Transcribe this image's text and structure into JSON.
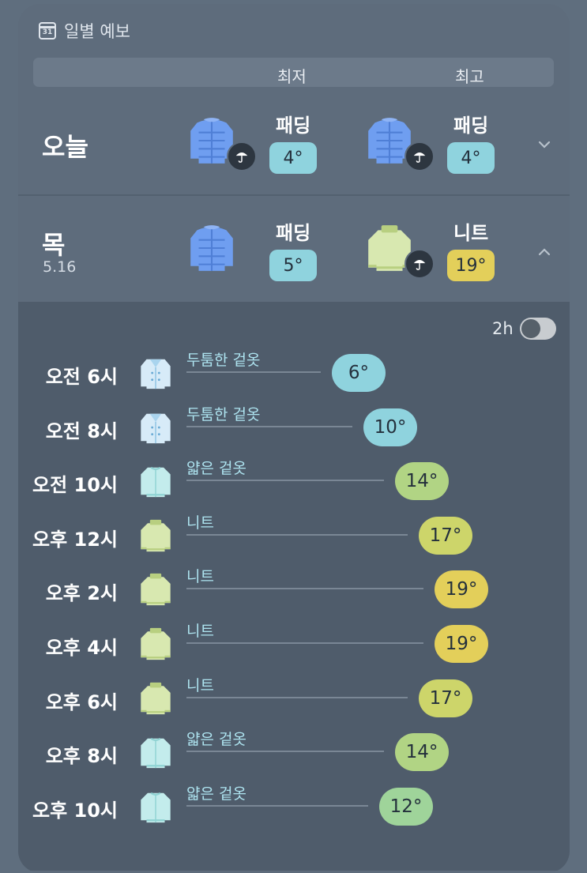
{
  "header": {
    "icon": "calendar-icon",
    "calendar_day": "31",
    "title": "일별 예보"
  },
  "columns": {
    "min": "최저",
    "max": "최고"
  },
  "days": [
    {
      "day": "오늘",
      "date": "",
      "min": {
        "item": "패딩",
        "icon": "padded-jacket-icon",
        "rain": true,
        "temp": "4°",
        "color": "#8fd3de"
      },
      "max": {
        "item": "패딩",
        "icon": "padded-jacket-icon",
        "rain": true,
        "temp": "4°",
        "color": "#8fd3de"
      },
      "expanded": false
    },
    {
      "day": "목",
      "date": "5.16",
      "min": {
        "item": "패딩",
        "icon": "padded-jacket-icon",
        "rain": false,
        "temp": "5°",
        "color": "#8fd3de"
      },
      "max": {
        "item": "니트",
        "icon": "knit-sweater-icon",
        "rain": true,
        "temp": "19°",
        "color": "#e3cf5a"
      },
      "expanded": true
    }
  ],
  "hourly": {
    "interval_label": "2h",
    "interval_toggle_on": true,
    "rows": [
      {
        "time": "오전 6시",
        "item": "두툼한 겉옷",
        "icon": "thick-coat-icon",
        "temp": "6°",
        "temp_value": 6,
        "color": "#8fd3de"
      },
      {
        "time": "오전 8시",
        "item": "두툼한 겉옷",
        "icon": "thick-coat-icon",
        "temp": "10°",
        "temp_value": 10,
        "color": "#8fd3de"
      },
      {
        "time": "오전 10시",
        "item": "얇은 겉옷",
        "icon": "light-jacket-icon",
        "temp": "14°",
        "temp_value": 14,
        "color": "#b1d484"
      },
      {
        "time": "오후 12시",
        "item": "니트",
        "icon": "knit-sweater-icon",
        "temp": "17°",
        "temp_value": 17,
        "color": "#cdd56a"
      },
      {
        "time": "오후 2시",
        "item": "니트",
        "icon": "knit-sweater-icon",
        "temp": "19°",
        "temp_value": 19,
        "color": "#e3cf5a"
      },
      {
        "time": "오후 4시",
        "item": "니트",
        "icon": "knit-sweater-icon",
        "temp": "19°",
        "temp_value": 19,
        "color": "#e3cf5a"
      },
      {
        "time": "오후 6시",
        "item": "니트",
        "icon": "knit-sweater-icon",
        "temp": "17°",
        "temp_value": 17,
        "color": "#cdd56a"
      },
      {
        "time": "오후 8시",
        "item": "얇은 겉옷",
        "icon": "light-jacket-icon",
        "temp": "14°",
        "temp_value": 14,
        "color": "#b1d484"
      },
      {
        "time": "오후 10시",
        "item": "얇은 겉옷",
        "icon": "light-jacket-icon",
        "temp": "12°",
        "temp_value": 12,
        "color": "#9fd49a"
      }
    ]
  }
}
